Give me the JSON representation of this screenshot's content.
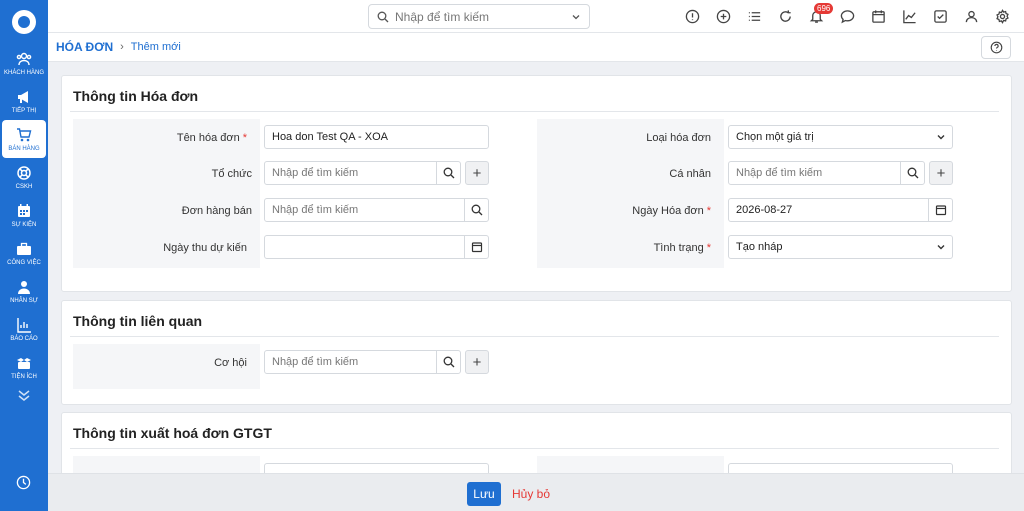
{
  "sidebar": {
    "items": [
      {
        "label": "KHÁCH HÀNG",
        "icon": "users-icon"
      },
      {
        "label": "TIẾP THỊ",
        "icon": "megaphone-icon"
      },
      {
        "label": "BÁN HÀNG",
        "icon": "cart-icon"
      },
      {
        "label": "CSKH",
        "icon": "lifebuoy-icon"
      },
      {
        "label": "SỰ KIỆN",
        "icon": "calendar-icon"
      },
      {
        "label": "CÔNG VIỆC",
        "icon": "briefcase-icon"
      },
      {
        "label": "NHÂN SỰ",
        "icon": "person-icon"
      },
      {
        "label": "BÁO CÁO",
        "icon": "report-icon"
      },
      {
        "label": "TIỆN ÍCH",
        "icon": "utilities-icon"
      }
    ],
    "active_index": 2
  },
  "topbar": {
    "search_placeholder": "Nhập để tìm kiếm",
    "notification_count": "696"
  },
  "breadcrumb": {
    "main": "HÓA ĐƠN",
    "sub": "Thêm mới"
  },
  "section1": {
    "title": "Thông tin Hóa đơn",
    "fields": {
      "ten_hoa_don": {
        "label": "Tên hóa đơn",
        "value": "Hoa don Test QA - XOA"
      },
      "to_chuc": {
        "label": "Tổ chức",
        "placeholder": "Nhập để tìm kiếm"
      },
      "don_hang_ban": {
        "label": "Đơn hàng bán",
        "placeholder": "Nhập để tìm kiếm"
      },
      "ngay_thu_du_kien": {
        "label": "Ngày thu dự kiến",
        "value": ""
      },
      "loai_hoa_don": {
        "label": "Loại hóa đơn",
        "value": "Chọn một giá trị"
      },
      "ca_nhan": {
        "label": "Cá nhân",
        "placeholder": "Nhập để tìm kiếm"
      },
      "ngay_hoa_don": {
        "label": "Ngày Hóa đơn",
        "value": "2026-08-27"
      },
      "tinh_trang": {
        "label": "Tình trạng",
        "value": "Tạo nháp"
      }
    },
    "required_mark": "*"
  },
  "section2": {
    "title": "Thông tin liên quan",
    "fields": {
      "co_hoi": {
        "label": "Cơ hội",
        "placeholder": "Nhập để tìm kiếm"
      }
    }
  },
  "section3": {
    "title": "Thông tin xuất hoá đơn GTGT"
  },
  "footer": {
    "save_label": "Lưu",
    "cancel_label": "Hủy bỏ"
  },
  "colors": {
    "brand": "#1f6fd1",
    "required": "#e53935"
  }
}
